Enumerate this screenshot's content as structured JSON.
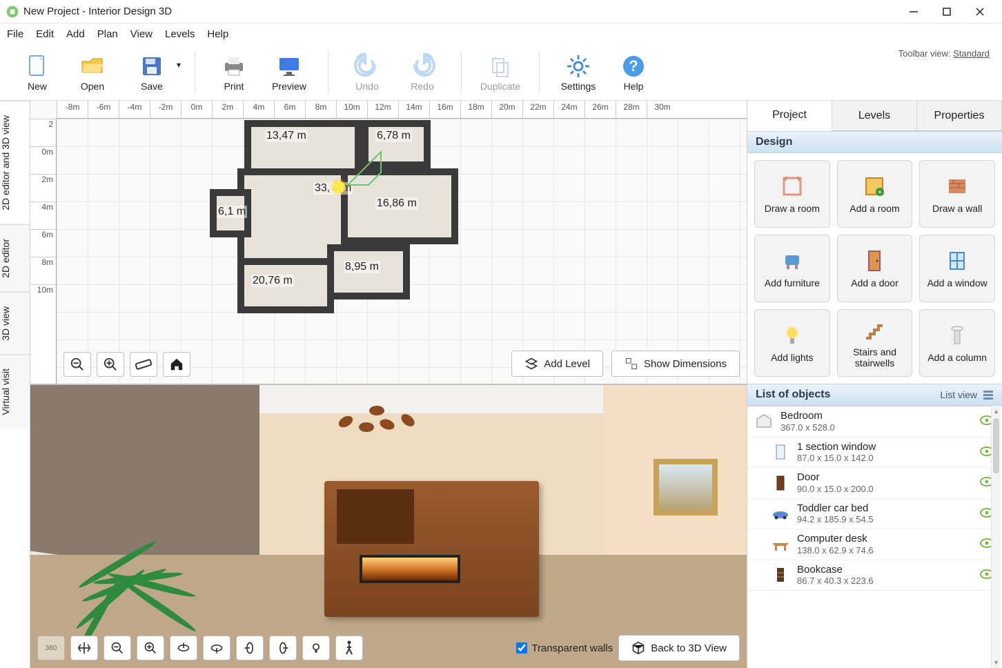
{
  "title": "New Project - Interior Design 3D",
  "menu": [
    "File",
    "Edit",
    "Add",
    "Plan",
    "View",
    "Levels",
    "Help"
  ],
  "toolbar_view_label": "Toolbar view:",
  "toolbar_view_value": "Standard",
  "toolbar": {
    "new": "New",
    "open": "Open",
    "save": "Save",
    "print": "Print",
    "preview": "Preview",
    "undo": "Undo",
    "redo": "Redo",
    "duplicate": "Duplicate",
    "settings": "Settings",
    "help": "Help"
  },
  "side_tabs": [
    "2D editor and 3D view",
    "2D editor",
    "3D view",
    "Virtual visit"
  ],
  "hruler": [
    "-8m",
    "-6m",
    "-4m",
    "-2m",
    "0m",
    "2m",
    "4m",
    "6m",
    "8m",
    "10m",
    "12m",
    "14m",
    "16m",
    "18m",
    "20m",
    "22m",
    "24m",
    "26m",
    "28m",
    "30m"
  ],
  "vruler": [
    "2",
    "0m",
    "2m",
    "4m",
    "6m",
    "8m",
    "10m"
  ],
  "room_labels": [
    "13,47 m",
    "6,78 m",
    "33,  9 m",
    "16,86 m",
    "6,1 m",
    "20,76 m",
    "8,95 m"
  ],
  "plan2d_buttons": {
    "add_level": "Add Level",
    "show_dim": "Show Dimensions"
  },
  "plan3d": {
    "transparent": "Transparent walls",
    "back3d": "Back to 3D View"
  },
  "right_tabs": [
    "Project",
    "Levels",
    "Properties"
  ],
  "section_design": "Design",
  "design_buttons": [
    "Draw a room",
    "Add a room",
    "Draw a wall",
    "Add furniture",
    "Add a door",
    "Add a window",
    "Add lights",
    "Stairs and stairwells",
    "Add a column"
  ],
  "section_objects": "List of objects",
  "list_view_label": "List view",
  "objects": [
    {
      "name": "Bedroom",
      "dim": "367.0 x 528.0",
      "child": false,
      "icon": "room"
    },
    {
      "name": "1 section window",
      "dim": "87.0 x 15.0 x 142.0",
      "child": true,
      "icon": "window"
    },
    {
      "name": "Door",
      "dim": "90.0 x 15.0 x 200.0",
      "child": true,
      "icon": "door"
    },
    {
      "name": "Toddler car bed",
      "dim": "94.2 x 185.9 x 54.5",
      "child": true,
      "icon": "car"
    },
    {
      "name": "Computer desk",
      "dim": "138.0 x 62.9 x 74.6",
      "child": true,
      "icon": "desk"
    },
    {
      "name": "Bookcase",
      "dim": "86.7 x 40.3 x 223.6",
      "child": true,
      "icon": "bookcase"
    }
  ]
}
